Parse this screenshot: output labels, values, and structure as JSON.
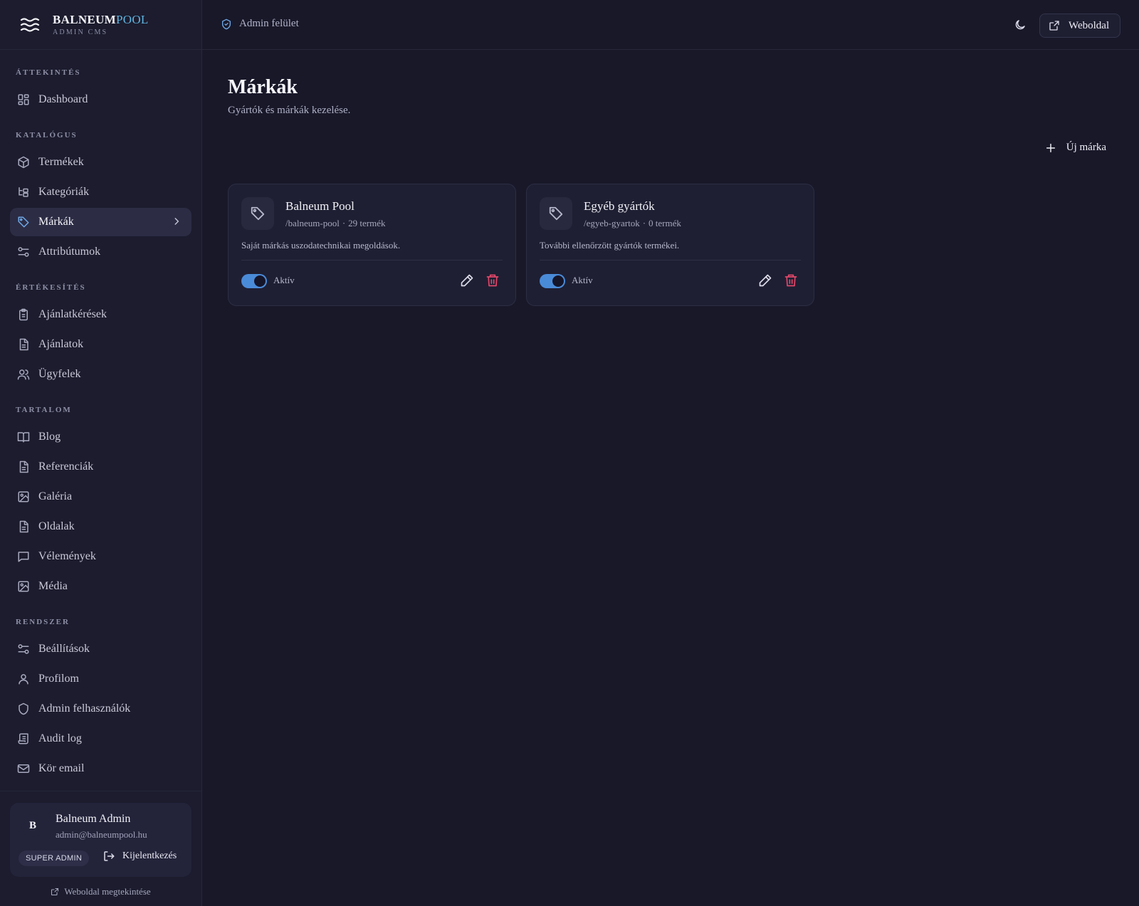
{
  "brand": {
    "name_main": "BALNEUM",
    "name_accent": "POOL",
    "subtitle": "ADMIN CMS"
  },
  "nav": {
    "sections": [
      {
        "label": "ÁTTEKINTÉS",
        "items": [
          {
            "label": "Dashboard",
            "icon": "dashboard-icon"
          }
        ]
      },
      {
        "label": "KATALÓGUS",
        "items": [
          {
            "label": "Termékek",
            "icon": "package-icon"
          },
          {
            "label": "Kategóriák",
            "icon": "category-tree-icon"
          },
          {
            "label": "Márkák",
            "icon": "tag-icon",
            "active": true
          },
          {
            "label": "Attribútumok",
            "icon": "sliders-icon"
          }
        ]
      },
      {
        "label": "ÉRTÉKESÍTÉS",
        "items": [
          {
            "label": "Ajánlatkérések",
            "icon": "clipboard-icon"
          },
          {
            "label": "Ajánlatok",
            "icon": "document-icon"
          },
          {
            "label": "Ügyfelek",
            "icon": "users-icon"
          }
        ]
      },
      {
        "label": "TARTALOM",
        "items": [
          {
            "label": "Blog",
            "icon": "book-icon"
          },
          {
            "label": "Referenciák",
            "icon": "document-icon"
          },
          {
            "label": "Galéria",
            "icon": "image-icon"
          },
          {
            "label": "Oldalak",
            "icon": "document-icon"
          },
          {
            "label": "Vélemények",
            "icon": "chat-icon"
          },
          {
            "label": "Média",
            "icon": "image-icon"
          }
        ]
      },
      {
        "label": "RENDSZER",
        "items": [
          {
            "label": "Beállítások",
            "icon": "sliders-icon"
          },
          {
            "label": "Profilom",
            "icon": "user-icon"
          },
          {
            "label": "Admin felhasználók",
            "icon": "shield-icon"
          },
          {
            "label": "Audit log",
            "icon": "scroll-icon"
          },
          {
            "label": "Kör email",
            "icon": "mail-icon"
          }
        ]
      }
    ]
  },
  "user": {
    "initial": "B",
    "name": "Balneum Admin",
    "email": "admin@balneumpool.hu",
    "role": "SUPER ADMIN",
    "logout_label": "Kijelentkezés",
    "view_site_label": "Weboldal megtekintése"
  },
  "topbar": {
    "breadcrumb": "Admin felület",
    "site_button": "Weboldal"
  },
  "page": {
    "title": "Márkák",
    "subtitle": "Gyártók és márkák kezelése.",
    "new_button": "Új márka"
  },
  "brands": [
    {
      "name": "Balneum Pool",
      "slug": "/balneum-pool",
      "separator": "·",
      "count": "29 termék",
      "description": "Saját márkás uszodatechnikai megoldások.",
      "status": "Aktív",
      "active": true
    },
    {
      "name": "Egyéb gyártók",
      "slug": "/egyeb-gyartok",
      "separator": "·",
      "count": "0 termék",
      "description": "További ellenőrzött gyártók termékei.",
      "status": "Aktív",
      "active": true
    }
  ],
  "colors": {
    "background": "#181829",
    "accent": "#4a8bd8",
    "danger": "#e2486a"
  }
}
